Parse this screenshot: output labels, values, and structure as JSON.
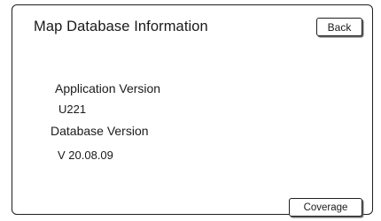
{
  "header": {
    "title": "Map Database Information",
    "back_label": "Back"
  },
  "info": {
    "application_version_label": "Application Version",
    "application_version_value": "U221",
    "database_version_label": "Database Version",
    "database_version_value": "V 20.08.09"
  },
  "footer": {
    "coverage_label": "Coverage"
  }
}
